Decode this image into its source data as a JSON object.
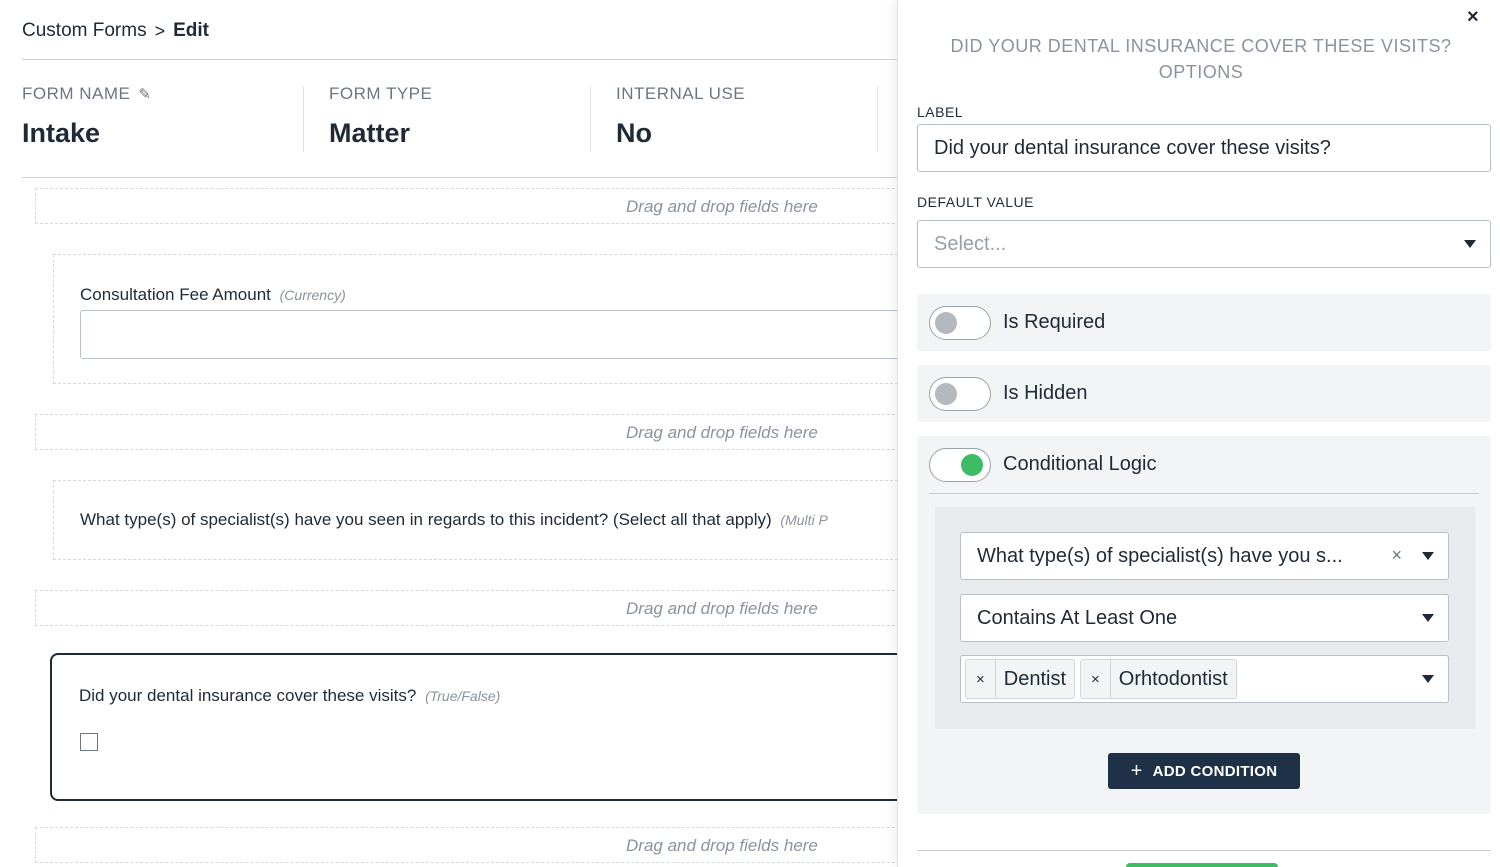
{
  "breadcrumb": {
    "root": "Custom Forms",
    "separator": ">",
    "current": "Edit"
  },
  "meta": {
    "form_name": {
      "label": "FORM NAME",
      "value": "Intake"
    },
    "form_type": {
      "label": "FORM TYPE",
      "value": "Matter"
    },
    "internal_use": {
      "label": "INTERNAL USE",
      "value": "No"
    }
  },
  "canvas": {
    "drop_text": "Drag and drop fields here",
    "fields": [
      {
        "label": "Consultation Fee Amount",
        "type": "(Currency)"
      },
      {
        "label": "What type(s) of specialist(s) have you seen in regards to this incident? (Select all that apply)",
        "type": "(Multi P"
      },
      {
        "label": "Did your dental insurance cover these visits?",
        "type": "(True/False)"
      }
    ]
  },
  "panel": {
    "title_line1": "DID YOUR DENTAL INSURANCE COVER THESE VISITS?",
    "title_line2": "OPTIONS",
    "close": "×",
    "label_caption": "LABEL",
    "label_value": "Did your dental insurance cover these visits?",
    "default_caption": "DEFAULT VALUE",
    "default_placeholder": "Select...",
    "toggles": {
      "required": {
        "label": "Is Required",
        "on": false
      },
      "hidden": {
        "label": "Is Hidden",
        "on": false
      },
      "conditional": {
        "label": "Conditional Logic",
        "on": true
      }
    },
    "condition": {
      "field": "What type(s) of specialist(s) have you s...",
      "clear": "×",
      "operator": "Contains At Least One",
      "values": [
        "Dentist",
        "Orhtodontist"
      ]
    },
    "add_condition": {
      "plus": "+",
      "label": "ADD CONDITION"
    }
  },
  "colors": {
    "accent_dark": "#1f3146",
    "toggle_on": "#3dbb67"
  }
}
